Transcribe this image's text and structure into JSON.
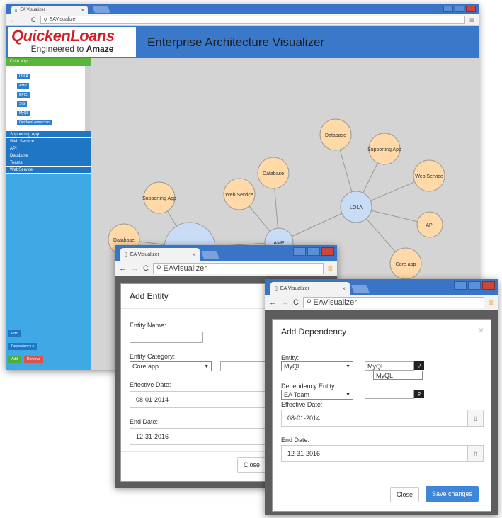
{
  "main_window": {
    "tab_title": "EA Visualizer",
    "address": "EAVisualizer",
    "logo": {
      "brand": "QuickenLoans",
      "tagline_prefix": "Engineered to ",
      "tagline_bold": "Amaze"
    },
    "app_title": "Enterprise Architecture Visualizer",
    "sidebar": {
      "active_category": "Core app",
      "core_items": [
        "LOLA",
        "AMP",
        "EPIC",
        "SIS",
        "MyQL",
        "QuickenLoans.com"
      ],
      "categories": [
        "Supporting App",
        "Web Service",
        "API",
        "Database",
        "Teams",
        "WebService"
      ],
      "buttons": {
        "edit": "Edit",
        "dependency": "Dependency",
        "add": "Add",
        "remove": "Remove"
      }
    },
    "graph": {
      "nodes": [
        {
          "label": "Database"
        },
        {
          "label": "Supporting App"
        },
        {
          "label": "Web Service"
        },
        {
          "label": "API"
        },
        {
          "label": "Core app"
        },
        {
          "label": "LOLA"
        },
        {
          "label": "Database"
        },
        {
          "label": "Web Service"
        },
        {
          "label": "AMP"
        },
        {
          "label": "Supporting App"
        },
        {
          "label": "Database"
        },
        {
          "label": ""
        }
      ]
    }
  },
  "add_entity_window": {
    "tab_title": "EA Visualizer",
    "address": "EAVisualizer",
    "modal_title": "Add Entity",
    "entity_name_label": "Entity Name:",
    "entity_name_value": "",
    "entity_category_label": "Entity Category:",
    "entity_category_value": "Core app",
    "effective_date_label": "Effective Date:",
    "effective_date_value": "08-01-2014",
    "end_date_label": "End Date:",
    "end_date_value": "12-31-2016",
    "close_label": "Close"
  },
  "add_dependency_window": {
    "tab_title": "EA Visualizer",
    "address": "EAVisualizer",
    "modal_title": "Add Dependency",
    "entity_label": "Entity:",
    "entity_value": "MyQL",
    "entity_search_value": "MyQL",
    "entity_suggestion": "MyQL",
    "dependency_entity_label": "Dependency Entity:",
    "dependency_entity_value": "EA Team",
    "dependency_search_value": "",
    "effective_date_label": "Effective Date:",
    "effective_date_value": "08-01-2014",
    "end_date_label": "End Date:",
    "end_date_value": "12-31-2016",
    "close_label": "Close",
    "save_label": "Save changes"
  },
  "colors": {
    "accent_blue": "#3a79c9",
    "node_fill": "#ffd9a8",
    "hub_fill": "#c9dcf5",
    "canvas": "#d4d4d4",
    "brand_red": "#d21f2a"
  }
}
